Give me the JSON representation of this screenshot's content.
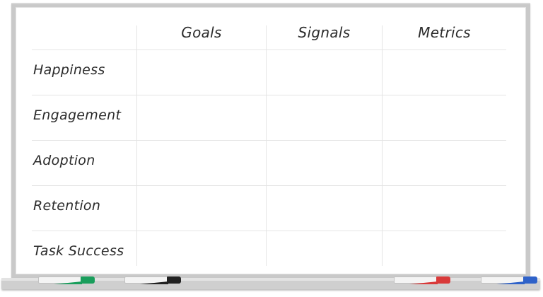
{
  "columns": [
    "Goals",
    "Signals",
    "Metrics"
  ],
  "rows": [
    "Happiness",
    "Engagement",
    "Adoption",
    "Retention",
    "Task Success"
  ],
  "markers": [
    {
      "name": "green-marker",
      "color": "#1a9e5c"
    },
    {
      "name": "black-marker",
      "color": "#222222"
    },
    {
      "name": "red-marker",
      "color": "#d93a3a"
    },
    {
      "name": "blue-marker",
      "color": "#2f62c9"
    }
  ]
}
